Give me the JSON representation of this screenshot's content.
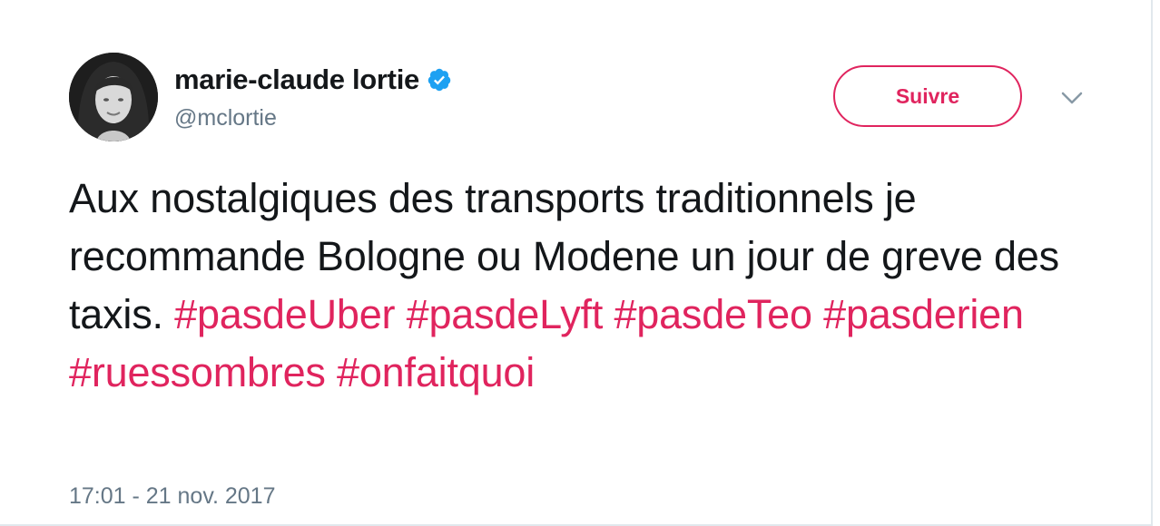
{
  "author": {
    "display_name": "marie-claude lortie",
    "handle": "@mclortie",
    "verified_icon": "verified-badge-icon",
    "avatar_icon": "profile-photo"
  },
  "actions": {
    "follow_label": "Suivre",
    "more_icon": "chevron-down-icon"
  },
  "tweet": {
    "text_plain": "Aux nostalgiques des transports traditionnels je recommande Bologne ou Modene un jour de greve des taxis.",
    "hashtags": [
      "#pasdeUber",
      "#pasdeLyft",
      "#pasdeTeo",
      "#pasderien",
      "#ruessombres",
      "#onfaitquoi"
    ],
    "timestamp": "17:01 - 21 nov. 2017"
  },
  "colors": {
    "accent": "#e0245e",
    "verified": "#1da1f2",
    "text": "#14171a",
    "secondary": "#657786"
  }
}
